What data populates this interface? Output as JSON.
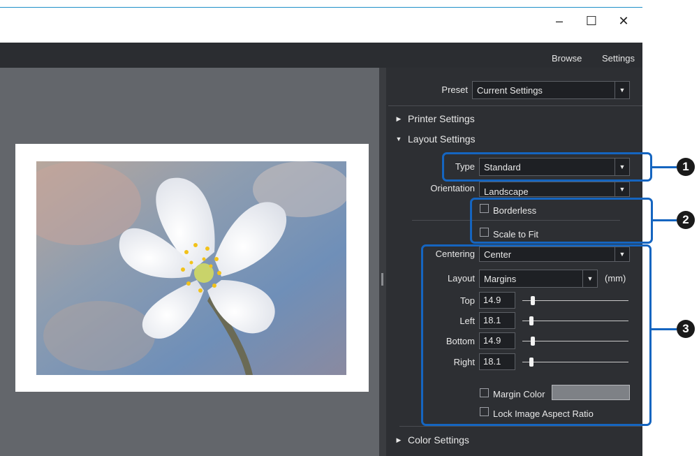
{
  "window": {
    "minimize_glyph": "–",
    "maximize_glyph": "☐",
    "close_glyph": "✕"
  },
  "menu": {
    "items": [
      "Browse",
      "Settings"
    ]
  },
  "panel": {
    "preset": {
      "label": "Preset",
      "value": "Current Settings"
    },
    "printer_settings": {
      "label": "Printer Settings",
      "expanded": false
    },
    "layout_settings": {
      "label": "Layout Settings",
      "expanded": true,
      "type": {
        "label": "Type",
        "value": "Standard"
      },
      "orientation": {
        "label": "Orientation",
        "value": "Landscape"
      },
      "borderless": {
        "label": "Borderless",
        "checked": false
      },
      "scale_to_fit": {
        "label": "Scale to Fit",
        "checked": false
      },
      "centering": {
        "label": "Centering",
        "value": "Center"
      },
      "layout": {
        "label": "Layout",
        "value": "Margins",
        "unit": "(mm)"
      },
      "margins": [
        {
          "label": "Top",
          "value": "14.9"
        },
        {
          "label": "Left",
          "value": "18.1"
        },
        {
          "label": "Bottom",
          "value": "14.9"
        },
        {
          "label": "Right",
          "value": "18.1"
        }
      ],
      "margin_color": {
        "label": "Margin Color",
        "checked": false
      },
      "lock_aspect": {
        "label": "Lock Image Aspect Ratio",
        "checked": false
      }
    },
    "color_settings": {
      "label": "Color Settings",
      "expanded": false
    }
  },
  "callouts": [
    "1",
    "2",
    "3"
  ],
  "colors": {
    "accent": "#1565c0",
    "panel_bg": "#2d2f33",
    "preview_bg": "#63666b"
  }
}
